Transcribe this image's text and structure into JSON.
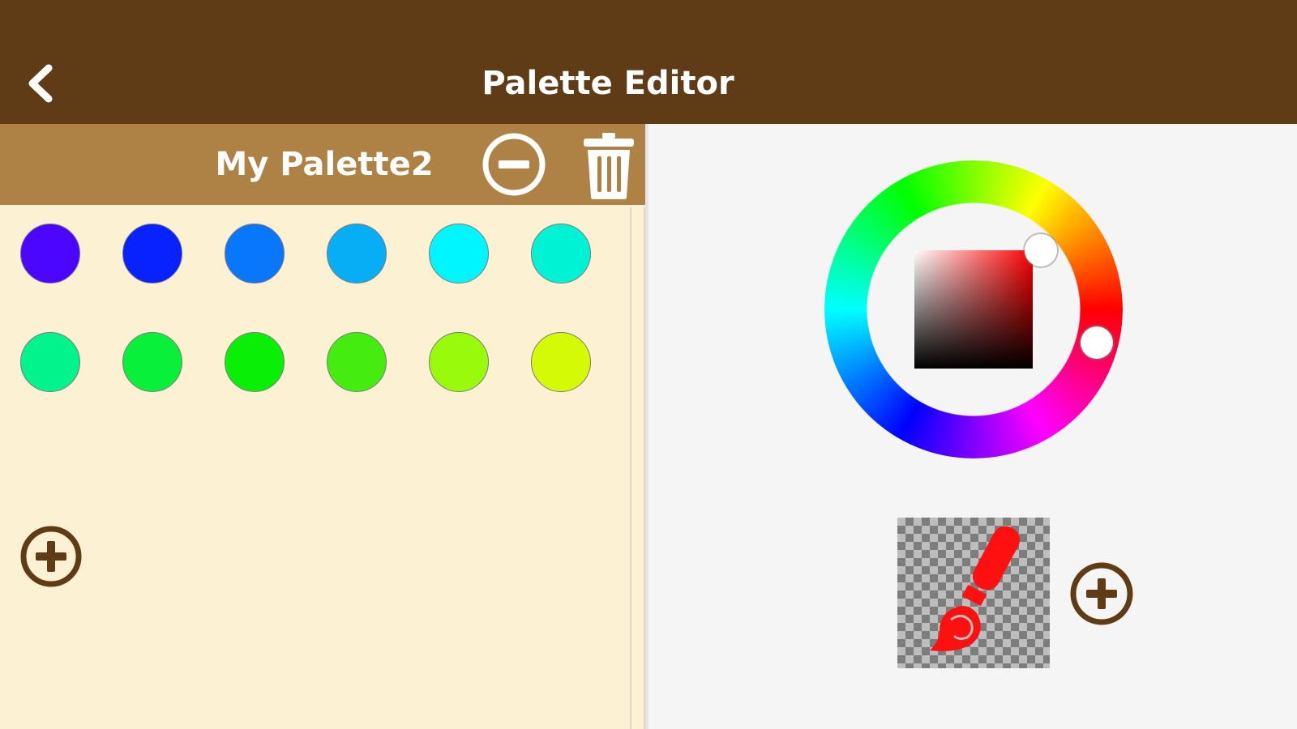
{
  "header": {
    "title": "Palette Editor",
    "background": "#5f3c15",
    "back_icon": "chevron-left-icon"
  },
  "palette": {
    "name": "My Palette2",
    "header_background": "#ae8245",
    "background": "#fdf1d4",
    "remove_icon": "minus-circle-icon",
    "delete_icon": "trash-icon",
    "add_icon": "plus-circle-icon",
    "swatches": [
      {
        "color": "#4b06ff"
      },
      {
        "color": "#0721ff"
      },
      {
        "color": "#0877fb"
      },
      {
        "color": "#08aef5"
      },
      {
        "color": "#00f6ff"
      },
      {
        "color": "#00f2d5"
      },
      {
        "color": "#00f48b"
      },
      {
        "color": "#08f03a"
      },
      {
        "color": "#0aef06"
      },
      {
        "color": "#45ec10"
      },
      {
        "color": "#99fa0c"
      },
      {
        "color": "#d5fa05"
      }
    ]
  },
  "picker": {
    "hue": 345,
    "saturation_value_square_hue_color": "#ff0000",
    "selected_color": "#ff1010",
    "preview_icon": "paintbrush-icon",
    "add_icon": "plus-circle-icon"
  }
}
